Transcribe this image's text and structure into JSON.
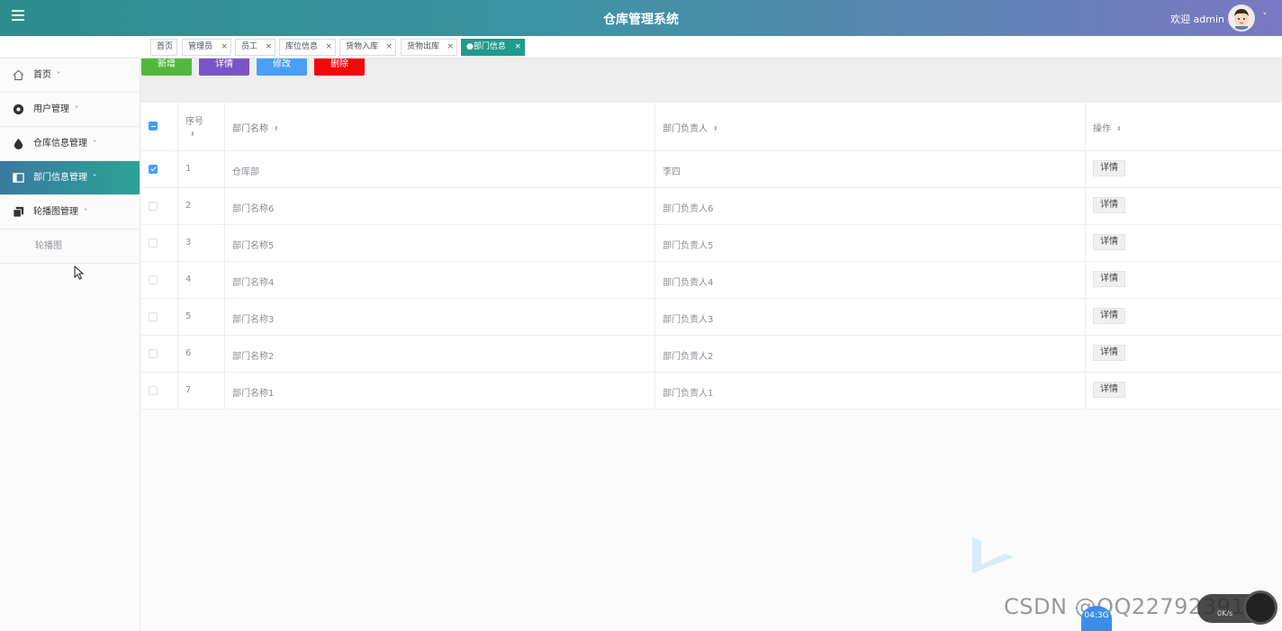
{
  "header": {
    "title": "仓库管理系统",
    "welcome": "欢迎 admin",
    "menu_icon": "hamburger-icon",
    "avatar_icon": "user-avatar",
    "caret": "˅"
  },
  "tags": [
    {
      "label": "首页",
      "closable": false
    },
    {
      "label": "管理员",
      "closable": true
    },
    {
      "label": "员工",
      "closable": true
    },
    {
      "label": "库位信息",
      "closable": true
    },
    {
      "label": "货物入库",
      "closable": true
    },
    {
      "label": "货物出库",
      "closable": true
    },
    {
      "label": "●部门信息",
      "closable": true,
      "active": true
    }
  ],
  "close_glyph": "×",
  "sidebar": {
    "items": [
      {
        "label": "首页",
        "icon": "home-icon",
        "caret": "˅"
      },
      {
        "label": "用户管理",
        "icon": "user-circle-icon",
        "caret": "˅"
      },
      {
        "label": "仓库信息管理",
        "icon": "drop-icon",
        "caret": "˅"
      },
      {
        "label": "部门信息管理",
        "icon": "panel-icon",
        "caret": "˅",
        "active": true
      },
      {
        "label": "轮播图管理",
        "icon": "copy-icon",
        "caret": "˄"
      }
    ],
    "subitems": [
      {
        "label": "轮播图"
      }
    ]
  },
  "toolbar": {
    "add": "新增",
    "detail": "详情",
    "edit": "修改",
    "delete": "删除"
  },
  "table": {
    "columns": [
      "序号",
      "部门名称",
      "部门负责人",
      "操作"
    ],
    "sort_glyph": "⬍",
    "action_label": "详情",
    "rows": [
      {
        "seq": "1",
        "name": "仓库部",
        "manager": "李四",
        "checked": true
      },
      {
        "seq": "2",
        "name": "部门名称6",
        "manager": "部门负责人6",
        "checked": false
      },
      {
        "seq": "3",
        "name": "部门名称5",
        "manager": "部门负责人5",
        "checked": false
      },
      {
        "seq": "4",
        "name": "部门名称4",
        "manager": "部门负责人4",
        "checked": false
      },
      {
        "seq": "5",
        "name": "部门名称3",
        "manager": "部门负责人3",
        "checked": false
      },
      {
        "seq": "6",
        "name": "部门名称2",
        "manager": "部门负责人2",
        "checked": false
      },
      {
        "seq": "7",
        "name": "部门名称1",
        "manager": "部门负责人1",
        "checked": false
      }
    ]
  },
  "overlay": {
    "watermark": "CSDN @QQ2279239102",
    "badge": "04:3G",
    "speed": "0K/s"
  },
  "colors": {
    "accent_teal": "#1f9b8c",
    "btn_add": "#52b83d",
    "btn_detail": "#7b55c7",
    "btn_edit": "#4a9ff5",
    "btn_delete": "#f00a0a"
  }
}
